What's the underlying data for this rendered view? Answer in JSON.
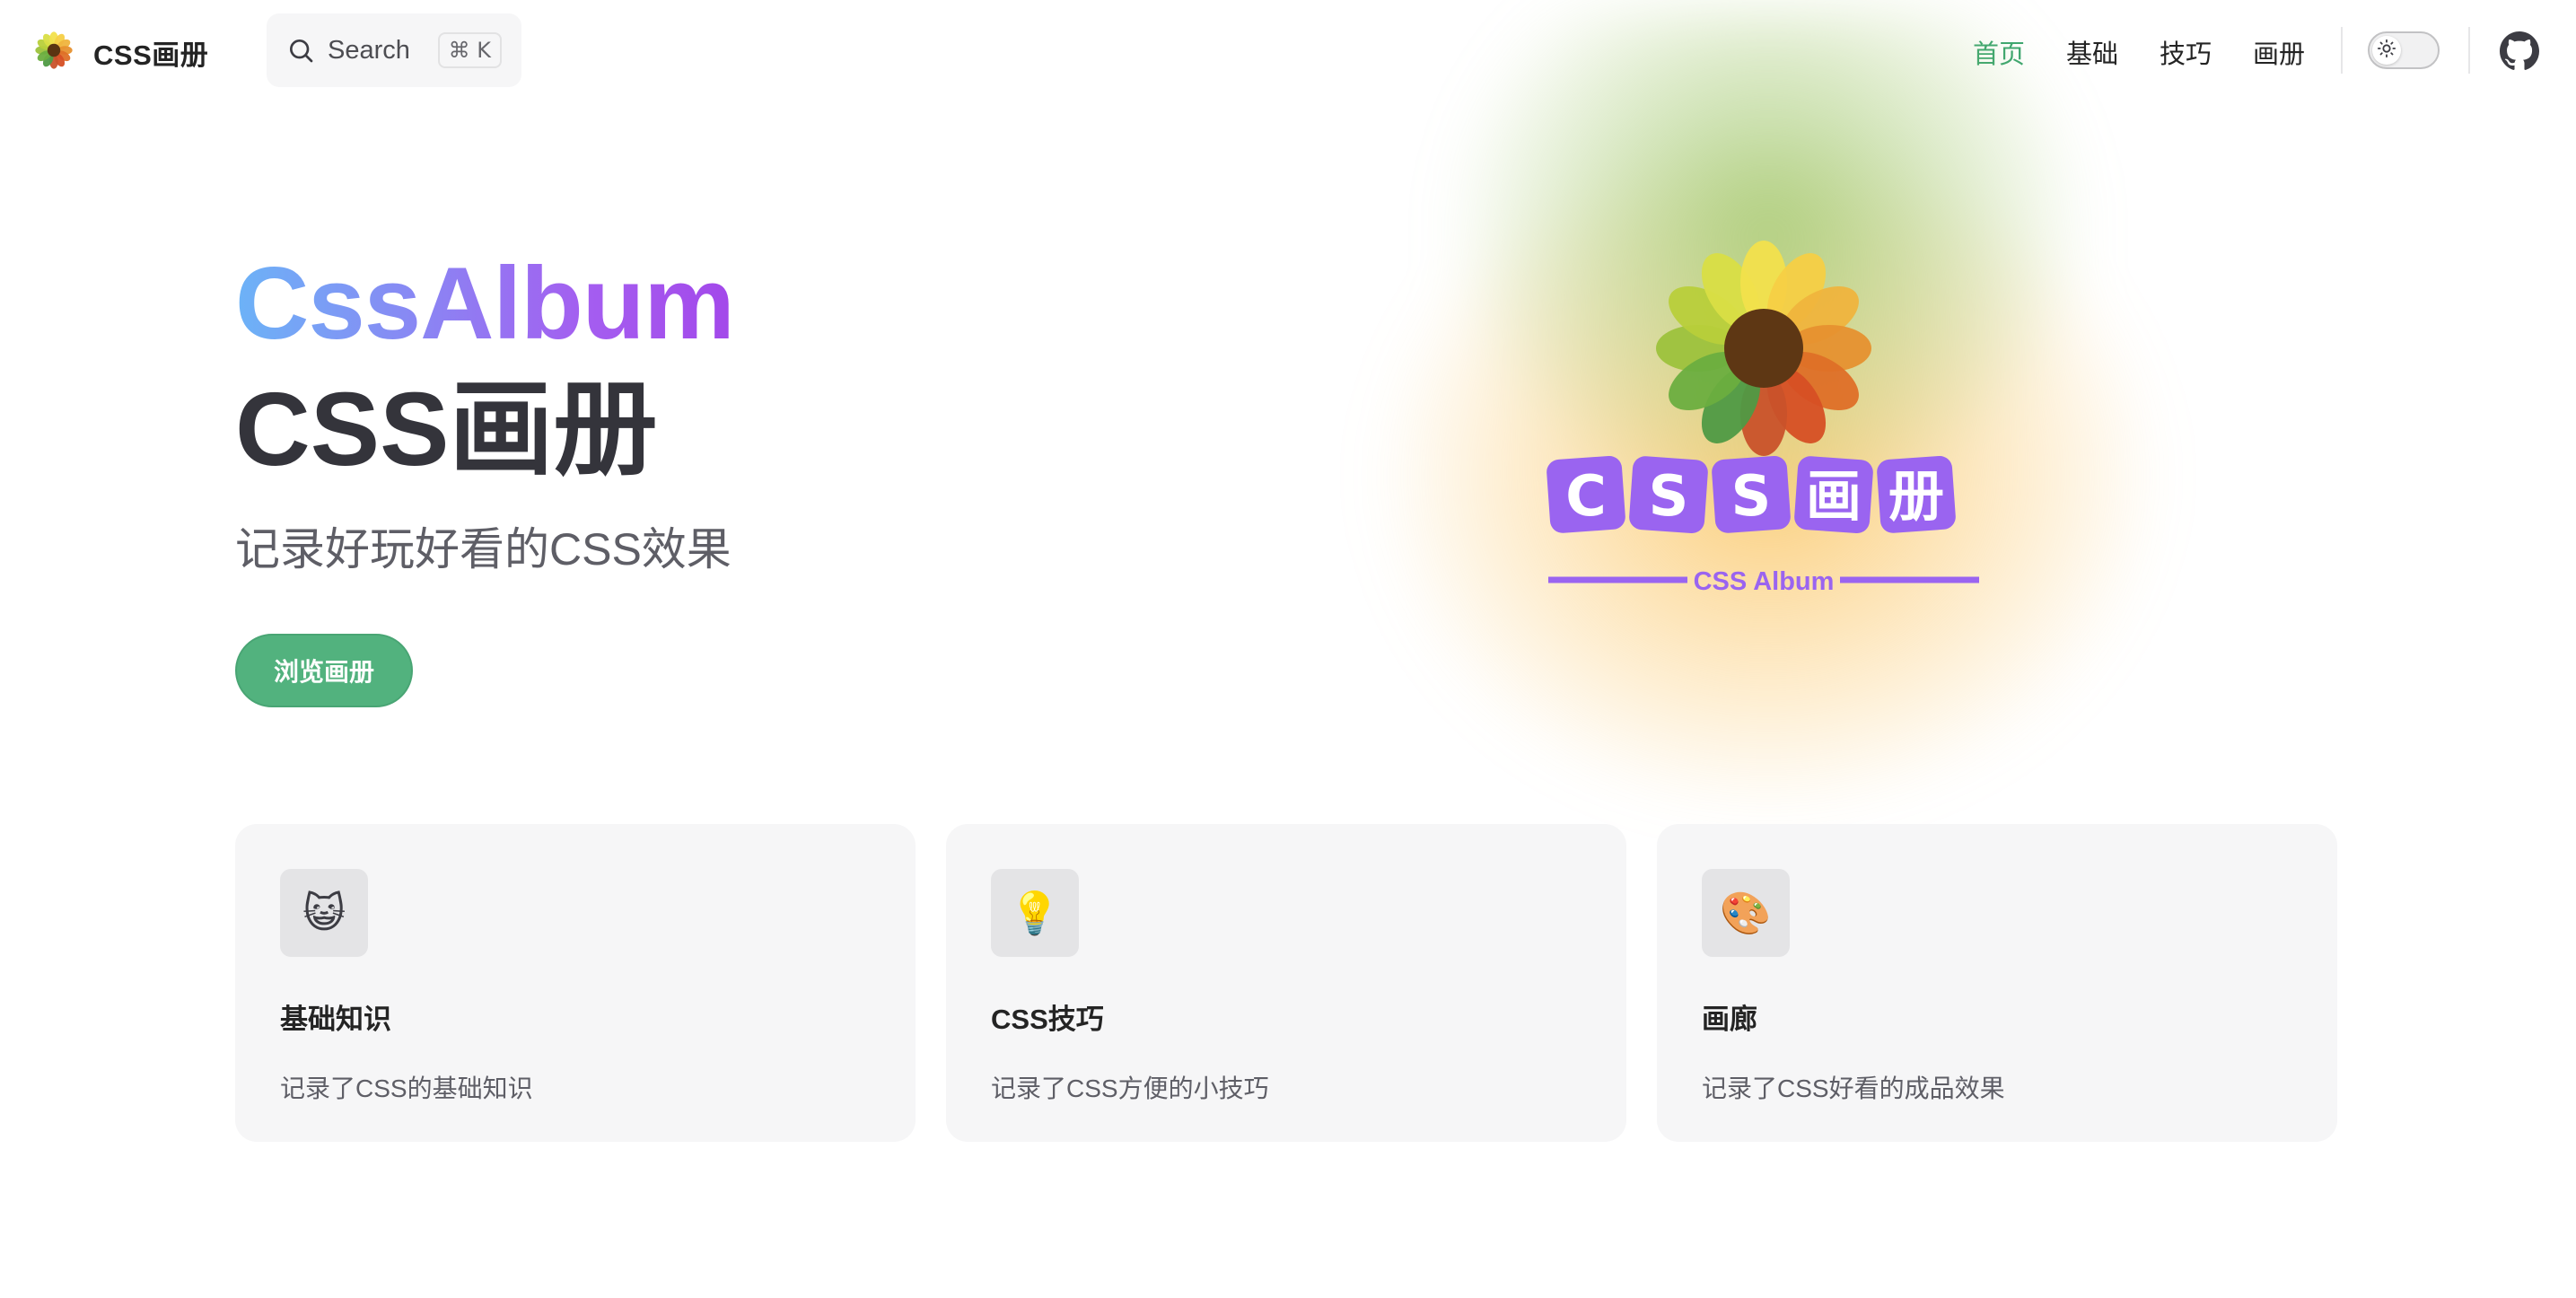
{
  "nav": {
    "brand_title": "CSS画册",
    "search_label": "Search",
    "search_shortcut": "⌘ K",
    "links": [
      {
        "label": "首页",
        "active": true
      },
      {
        "label": "基础",
        "active": false
      },
      {
        "label": "技巧",
        "active": false
      },
      {
        "label": "画册",
        "active": false
      }
    ],
    "theme_icon": "sun-icon",
    "github_icon": "github-icon"
  },
  "hero": {
    "name": "CssAlbum",
    "text": "CSS画册",
    "tagline": "记录好玩好看的CSS效果",
    "action_label": "浏览画册",
    "logo": {
      "wordmark_chars": [
        "C",
        "S",
        "S",
        "画",
        "册"
      ],
      "subtitle": "CSS Album"
    }
  },
  "features": [
    {
      "icon": "😺",
      "title": "基础知识",
      "details": "记录了CSS的基础知识"
    },
    {
      "icon": "💡",
      "title": "CSS技巧",
      "details": "记录了CSS方便的小技巧"
    },
    {
      "icon": "🎨",
      "title": "画廊",
      "details": "记录了CSS好看的成品效果"
    }
  ],
  "colors": {
    "brand_green": "#3ba56f",
    "button_green": "#52b27e",
    "logo_purple": "#9a64f0",
    "name_gradient": [
      "#6cb3f7",
      "#a348ea"
    ]
  }
}
